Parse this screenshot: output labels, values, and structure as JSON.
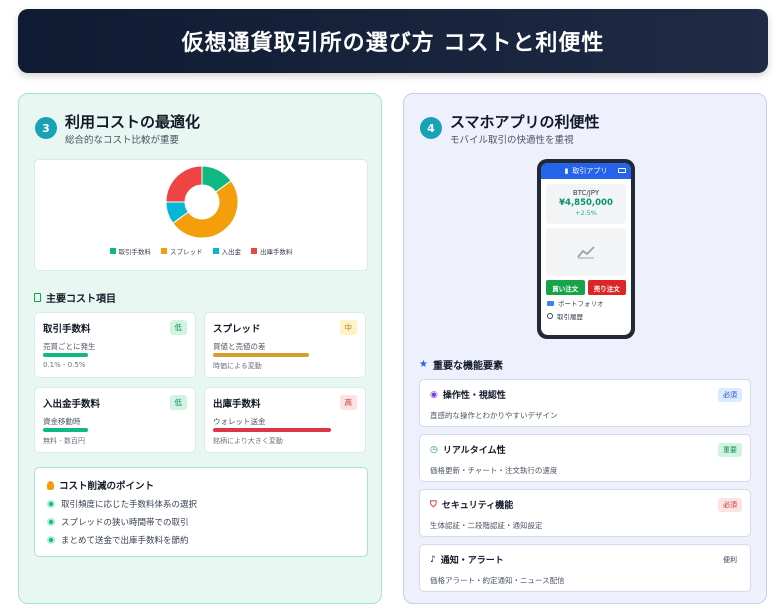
{
  "header": {
    "title": "仮想通貨取引所の選び方 コストと利便性"
  },
  "left": {
    "step": "3",
    "title": "利用コストの最適化",
    "subtitle": "総合的なコスト比較が重要",
    "chart_data": {
      "type": "pie",
      "categories": [
        "取引手数料",
        "スプレッド",
        "入出金",
        "出庫手数料"
      ],
      "values": [
        15,
        50,
        10,
        25
      ],
      "colors": [
        "#10b981",
        "#f59e0b",
        "#06b6d4",
        "#ef4444"
      ]
    },
    "section_title": "主要コスト項目",
    "costs": [
      {
        "name": "取引手数料",
        "level": "低",
        "desc": "売買ごとに発生",
        "note": "0.1% - 0.5%",
        "bar_fraction": 0.3,
        "color": "#10b981"
      },
      {
        "name": "スプレッド",
        "level": "中",
        "desc": "買値と売値の差",
        "note": "時価による変動",
        "bar_fraction": 0.68,
        "color": "#d69e2e"
      },
      {
        "name": "入出金手数料",
        "level": "低",
        "desc": "資金移動時",
        "note": "無料 - 数百円",
        "bar_fraction": 0.3,
        "color": "#10b981"
      },
      {
        "name": "出庫手数料",
        "level": "高",
        "desc": "ウォレット送金",
        "note": "銘柄により大きく変動",
        "bar_fraction": 0.8,
        "color": "#dc3545"
      }
    ],
    "tips": {
      "title": "コスト削減のポイント",
      "items": [
        "取引頻度に応じた手数料体系の選択",
        "スプレッドの狭い時間帯での取引",
        "まとめて送金で出庫手数料を節約"
      ]
    }
  },
  "right": {
    "step": "4",
    "title": "スマホアプリの利便性",
    "subtitle": "モバイル取引の快適性を重視",
    "phone": {
      "app_title": "取引アプリ",
      "pair": "BTC/JPY",
      "price": "¥4,850,000",
      "change": "+2.5%",
      "buy": "買い注文",
      "sell": "売り注文",
      "menu1": "ポートフォリオ",
      "menu2": "取引履歴"
    },
    "section_title": "重要な機能要素",
    "features": [
      {
        "title": "操作性・視認性",
        "tag": "必須",
        "desc": "直感的な操作とわかりやすいデザイン"
      },
      {
        "title": "リアルタイム性",
        "tag": "重要",
        "desc": "価格更新・チャート・注文執行の速度"
      },
      {
        "title": "セキュリティ機能",
        "tag": "必須",
        "desc": "生体認証・二段階認証・通知設定"
      },
      {
        "title": "通知・アラート",
        "tag": "便利",
        "desc": "価格アラート・約定通知・ニュース配信"
      }
    ]
  }
}
